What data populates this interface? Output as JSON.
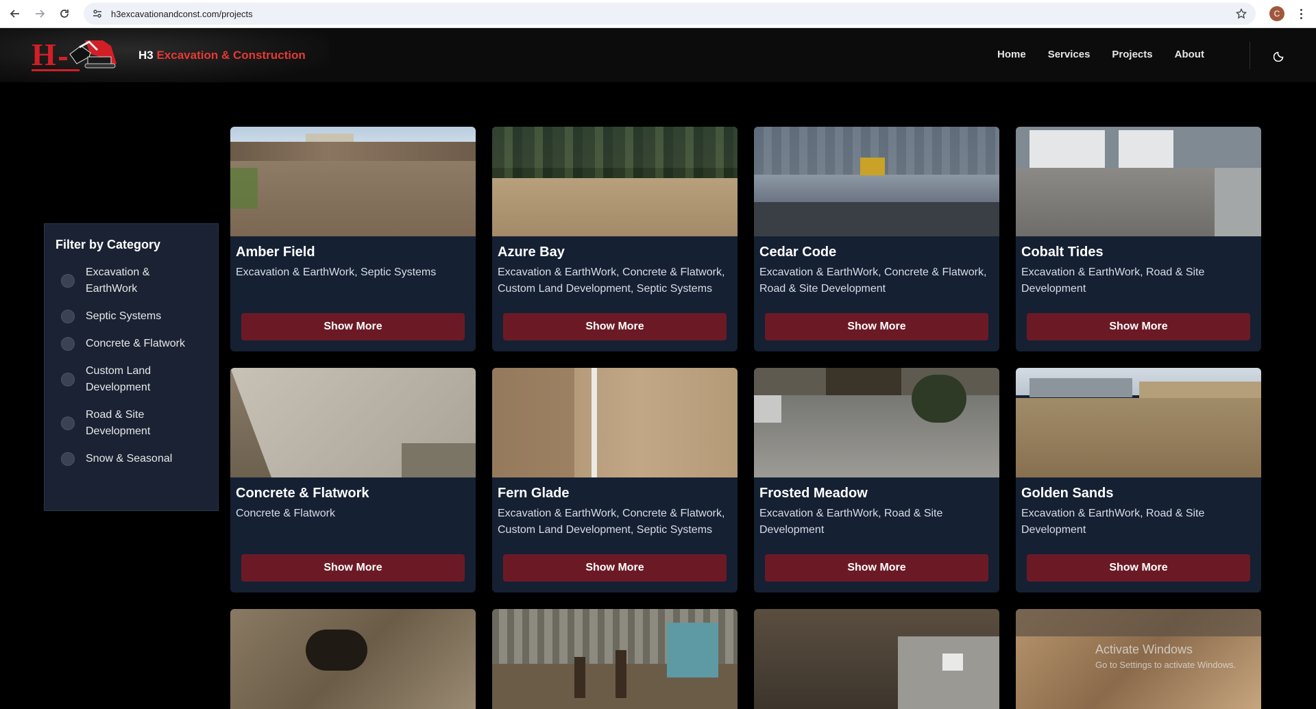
{
  "browser": {
    "url": "h3excavationandconst.com/projects",
    "profile_initial": "C"
  },
  "header": {
    "brand_prefix": "H3",
    "brand_rest": "Excavation & Construction",
    "nav": [
      "Home",
      "Services",
      "Projects",
      "About"
    ]
  },
  "sidebar": {
    "title": "Filter by Category",
    "filters": [
      "Excavation & EarthWork",
      "Septic Systems",
      "Concrete & Flatwork",
      "Custom Land Development",
      "Road & Site Development",
      "Snow & Seasonal"
    ]
  },
  "projects": [
    {
      "title": "Amber Field",
      "categories": "Excavation & EarthWork, Septic Systems",
      "button": "Show More"
    },
    {
      "title": "Azure Bay",
      "categories": "Excavation & EarthWork, Concrete & Flatwork, Custom Land Development, Septic Systems",
      "button": "Show More"
    },
    {
      "title": "Cedar Code",
      "categories": "Excavation & EarthWork, Concrete & Flatwork, Road & Site Development",
      "button": "Show More"
    },
    {
      "title": "Cobalt Tides",
      "categories": "Excavation & EarthWork, Road & Site Development",
      "button": "Show More"
    },
    {
      "title": "Concrete & Flatwork",
      "categories": "Concrete & Flatwork",
      "button": "Show More"
    },
    {
      "title": "Fern Glade",
      "categories": "Excavation & EarthWork, Concrete & Flatwork, Custom Land Development, Septic Systems",
      "button": "Show More"
    },
    {
      "title": "Frosted Meadow",
      "categories": "Excavation & EarthWork, Road & Site Development",
      "button": "Show More"
    },
    {
      "title": "Golden Sands",
      "categories": "Excavation & EarthWork, Road & Site Development",
      "button": "Show More"
    }
  ],
  "watermark": {
    "line1": "Activate Windows",
    "line2": "Go to Settings to activate Windows."
  },
  "colors": {
    "accent_red": "#e53935",
    "button_bg": "#6b1a25",
    "card_bg": "#152033",
    "sidebar_bg": "#1a2233"
  }
}
